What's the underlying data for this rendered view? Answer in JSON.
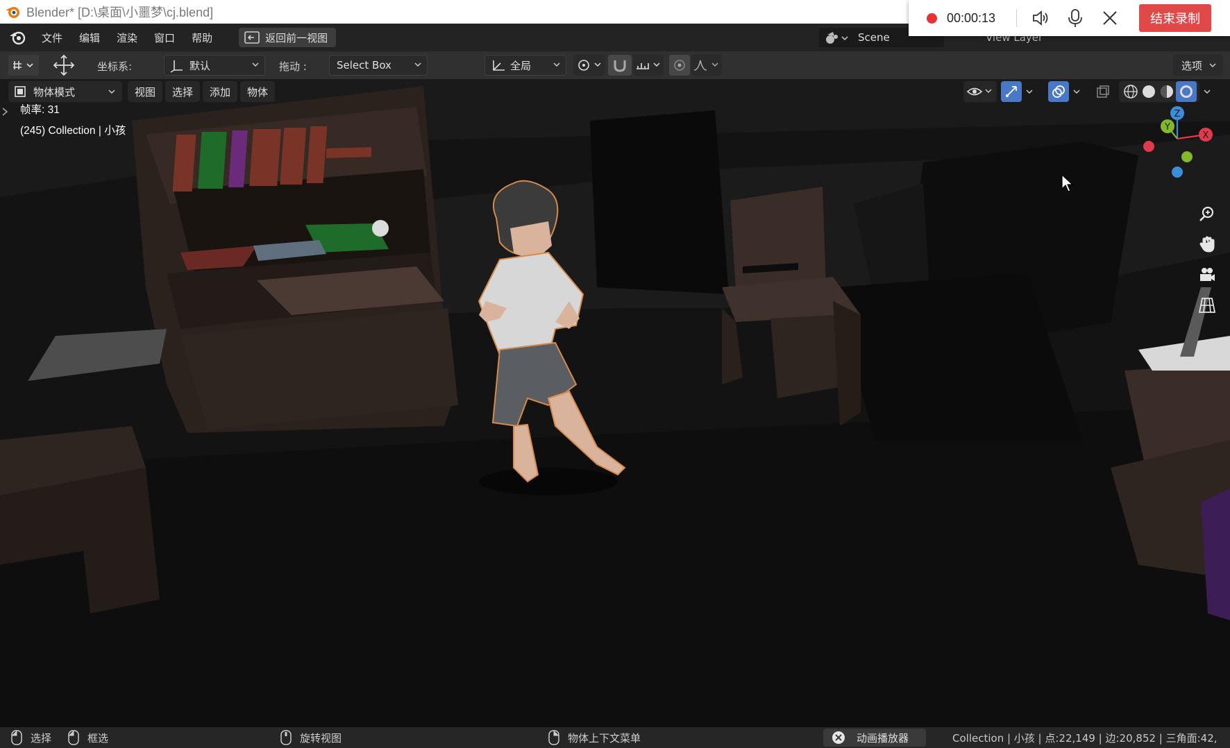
{
  "os_window": {
    "title": "Blender* [D:\\桌面\\小噩梦\\cj.blend]"
  },
  "recorder": {
    "time": "00:00:13",
    "stop_label": "结束录制",
    "record_color": "#e53333"
  },
  "menubar": {
    "items": [
      "文件",
      "编辑",
      "渲染",
      "窗口",
      "帮助"
    ],
    "back_button": "返回前一视图",
    "scene": "Scene",
    "view_layer": "View Layer"
  },
  "toolheader": {
    "coord_label": "坐标系:",
    "coord_value": "默认",
    "drag_label": "拖动 :",
    "drag_value": "Select Box",
    "transform_pivot": "全局",
    "options_label": "选项"
  },
  "viewport": {
    "mode": "物体模式",
    "menus": [
      "视图",
      "选择",
      "添加",
      "物体"
    ],
    "fps_text": "帧率: 31",
    "collection_text": "(245) Collection | 小孩",
    "gizmo_axes": [
      "Z",
      "Y",
      "X"
    ]
  },
  "statusbar": {
    "select": "选择",
    "box_select": "框选",
    "rotate_view": "旋转视图",
    "context_menu": "物体上下文菜单",
    "anim_player": "动画播放器",
    "stats": "Collection | 小孩 | 点:22,149 | 边:20,852 | 三角面:42,"
  },
  "colors": {
    "accent_blue": "#4a78c8",
    "axis_x": "#e03a4d",
    "axis_y": "#85b72c",
    "axis_z": "#3c8ed8"
  }
}
